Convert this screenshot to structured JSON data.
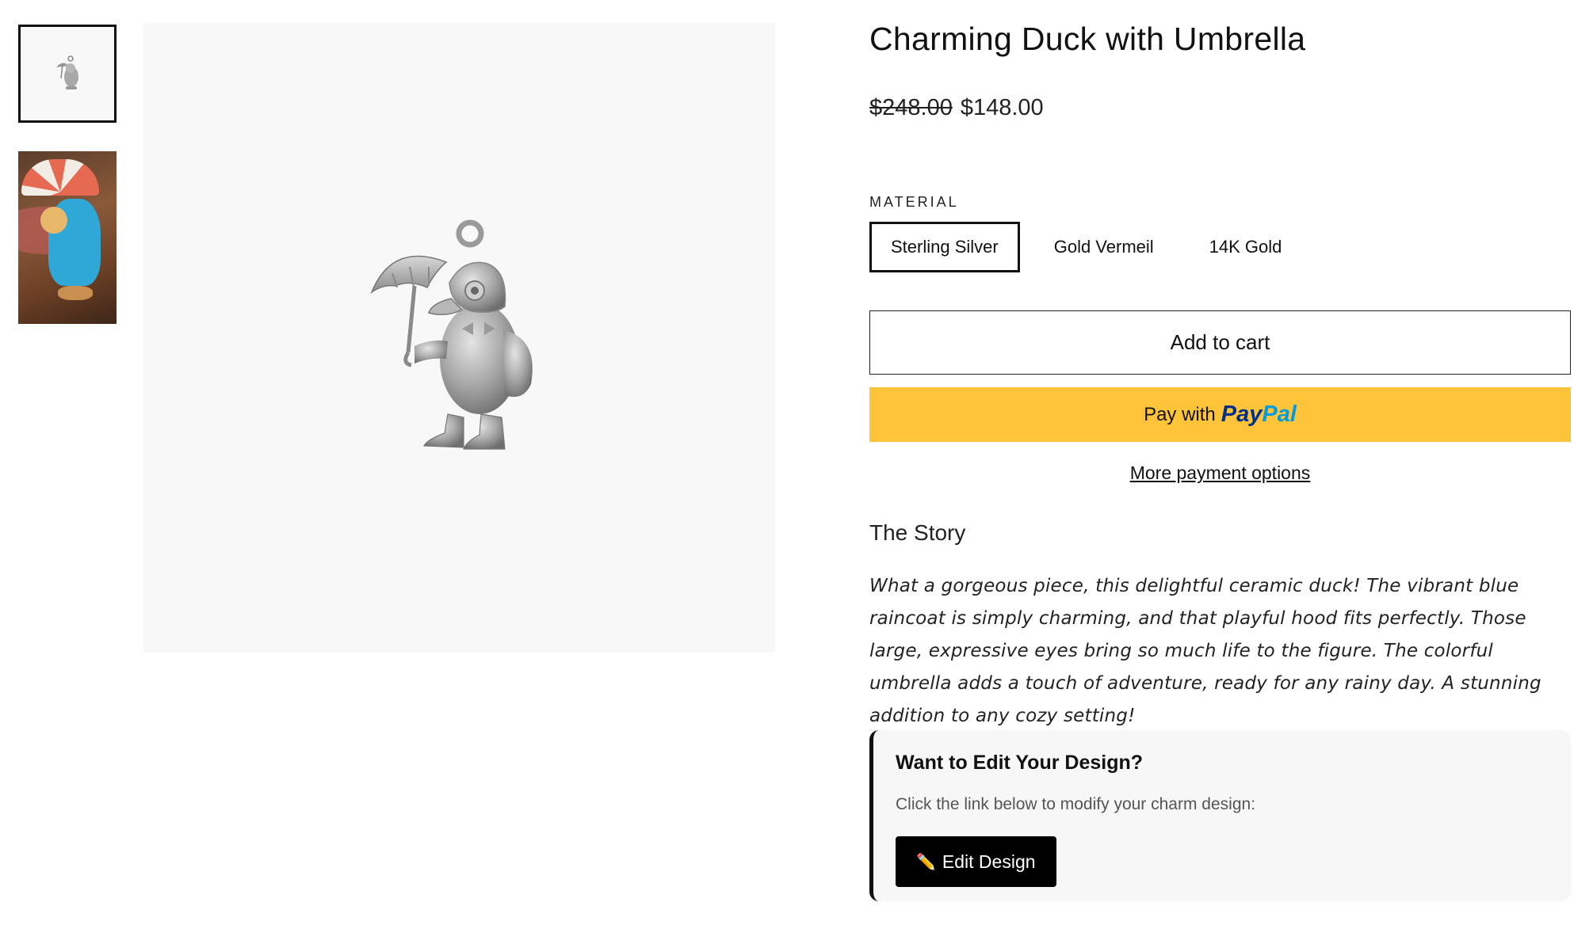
{
  "gallery": {
    "thumbnails": [
      {
        "alt": "Sterling silver duck charm",
        "selected": true
      },
      {
        "alt": "Ceramic duck with umbrella photo",
        "selected": false
      }
    ]
  },
  "product": {
    "title": "Charming Duck with Umbrella",
    "price_original": "$248.00",
    "price_sale": "$148.00"
  },
  "material": {
    "label": "MATERIAL",
    "options": [
      "Sterling Silver",
      "Gold Vermeil",
      "14K Gold"
    ],
    "selected": "Sterling Silver"
  },
  "buttons": {
    "add_to_cart": "Add to cart",
    "paypal_prefix": "Pay with",
    "paypal_brand_a": "Pay",
    "paypal_brand_b": "Pal",
    "more_payment": "More payment options"
  },
  "story": {
    "heading": "The Story",
    "text": "What a gorgeous piece, this delightful ceramic duck! The vibrant blue raincoat is simply charming, and that playful hood fits perfectly. Those large, expressive eyes bring so much life to the figure. The colorful umbrella adds a touch of adventure, ready for any rainy day. A stunning addition to any cozy setting!"
  },
  "edit": {
    "title": "Want to Edit Your Design?",
    "description": "Click the link below to modify your charm design:",
    "button_icon": "✏️",
    "button_label": "Edit Design"
  },
  "colors": {
    "paypal_yellow": "#ffc43a",
    "paypal_dark_blue": "#003087",
    "paypal_light_blue": "#009cde",
    "image_bg": "#f8f8f8"
  }
}
